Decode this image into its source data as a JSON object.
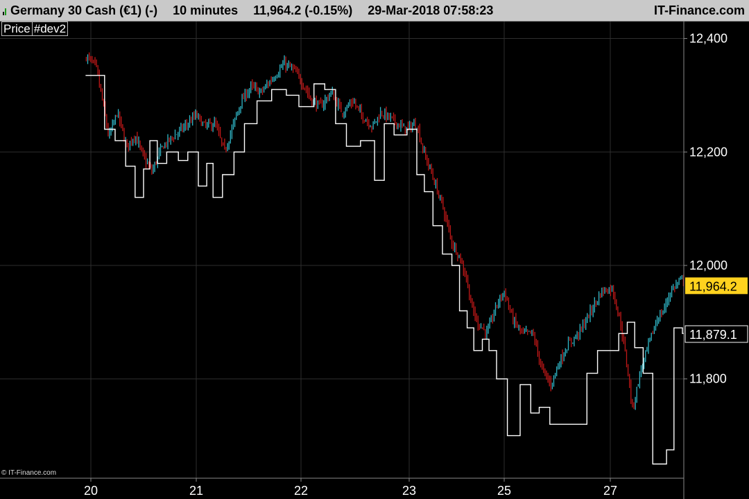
{
  "header": {
    "instrument": "Germany 30 Cash (€1) (-)",
    "timeframe": "10 minutes",
    "last": "11,964.2 (-0.15%)",
    "datetime": "29-Mar-2018 07:58:23",
    "brand": "IT-Finance.com"
  },
  "legend": {
    "price_label": "Price",
    "indicator_label": "#dev2"
  },
  "copyright": "© IT-Finance.com",
  "chart_data": {
    "type": "line",
    "xlabel": "",
    "ylabel": "",
    "x_tick_labels": [
      "20",
      "21",
      "22",
      "23",
      "25",
      "27"
    ],
    "ylim": [
      11625,
      12430
    ],
    "y_ticks": [
      11800,
      12000,
      12200,
      12400
    ],
    "y_tick_labels": [
      "11,800",
      "12,000",
      "12,200",
      "12,400"
    ],
    "grid": true,
    "price_badge": {
      "value": 11964.2,
      "label": "11,964.2"
    },
    "indicator_badge": {
      "value": 11879.1,
      "label": "11,879.1"
    },
    "colors": {
      "background": "#000000",
      "grid": "#2e2e2e",
      "up_bar": "#30b8c8",
      "down_bar": "#c01818",
      "indicator": "#ffffff",
      "price_badge": "#ffd21e"
    },
    "series": [
      {
        "type": "candlestick-trace",
        "points": [
          [
            -0.05,
            12370
          ],
          [
            0.05,
            12350
          ],
          [
            0.12,
            12280
          ],
          [
            0.17,
            12225
          ],
          [
            0.25,
            12270
          ],
          [
            0.34,
            12210
          ],
          [
            0.42,
            12230
          ],
          [
            0.5,
            12190
          ],
          [
            0.58,
            12165
          ],
          [
            0.68,
            12210
          ],
          [
            0.8,
            12230
          ],
          [
            0.92,
            12250
          ],
          [
            1.0,
            12265
          ],
          [
            1.08,
            12245
          ],
          [
            1.18,
            12250
          ],
          [
            1.27,
            12200
          ],
          [
            1.34,
            12240
          ],
          [
            1.42,
            12285
          ],
          [
            1.52,
            12315
          ],
          [
            1.62,
            12305
          ],
          [
            1.75,
            12335
          ],
          [
            1.84,
            12355
          ],
          [
            1.93,
            12345
          ],
          [
            2.02,
            12320
          ],
          [
            2.1,
            12290
          ],
          [
            2.18,
            12280
          ],
          [
            2.28,
            12305
          ],
          [
            2.38,
            12270
          ],
          [
            2.48,
            12290
          ],
          [
            2.56,
            12265
          ],
          [
            2.66,
            12245
          ],
          [
            2.74,
            12270
          ],
          [
            2.86,
            12255
          ],
          [
            2.96,
            12240
          ],
          [
            3.08,
            12250
          ],
          [
            3.15,
            12200
          ],
          [
            3.22,
            12170
          ],
          [
            3.3,
            12130
          ],
          [
            3.36,
            12100
          ],
          [
            3.45,
            12040
          ],
          [
            3.52,
            12020
          ],
          [
            3.6,
            11980
          ],
          [
            3.66,
            11925
          ],
          [
            3.72,
            11900
          ],
          [
            3.82,
            11880
          ],
          [
            3.92,
            11930
          ],
          [
            4.0,
            11955
          ],
          [
            4.08,
            11905
          ],
          [
            4.17,
            11880
          ],
          [
            4.27,
            11880
          ],
          [
            4.36,
            11815
          ],
          [
            4.44,
            11790
          ],
          [
            4.52,
            11830
          ],
          [
            4.6,
            11860
          ],
          [
            4.7,
            11880
          ],
          [
            4.82,
            11920
          ],
          [
            4.92,
            11955
          ],
          [
            5.02,
            11960
          ],
          [
            5.1,
            11895
          ],
          [
            5.16,
            11820
          ],
          [
            5.21,
            11745
          ],
          [
            5.28,
            11810
          ],
          [
            5.36,
            11860
          ],
          [
            5.44,
            11905
          ],
          [
            5.5,
            11920
          ],
          [
            5.57,
            11955
          ],
          [
            5.64,
            11970
          ],
          [
            5.72,
            11980
          ],
          [
            5.81,
            11955
          ],
          [
            5.89,
            11980
          ],
          [
            5.95,
            12010
          ],
          [
            6.03,
            11985
          ],
          [
            6.12,
            11970
          ],
          [
            6.28,
            11965
          ]
        ]
      },
      {
        "type": "step",
        "points": [
          [
            -0.05,
            12335
          ],
          [
            0.13,
            12240
          ],
          [
            0.23,
            12220
          ],
          [
            0.33,
            12175
          ],
          [
            0.42,
            12120
          ],
          [
            0.5,
            12170
          ],
          [
            0.56,
            12220
          ],
          [
            0.63,
            12180
          ],
          [
            0.72,
            12200
          ],
          [
            0.83,
            12185
          ],
          [
            0.92,
            12200
          ],
          [
            1.02,
            12140
          ],
          [
            1.1,
            12180
          ],
          [
            1.16,
            12120
          ],
          [
            1.25,
            12160
          ],
          [
            1.36,
            12200
          ],
          [
            1.46,
            12250
          ],
          [
            1.58,
            12290
          ],
          [
            1.72,
            12310
          ],
          [
            1.86,
            12300
          ],
          [
            1.98,
            12280
          ],
          [
            2.12,
            12320
          ],
          [
            2.22,
            12310
          ],
          [
            2.32,
            12250
          ],
          [
            2.42,
            12210
          ],
          [
            2.55,
            12220
          ],
          [
            2.68,
            12150
          ],
          [
            2.77,
            12250
          ],
          [
            2.86,
            12230
          ],
          [
            2.98,
            12240
          ],
          [
            3.08,
            12160
          ],
          [
            3.16,
            12130
          ],
          [
            3.25,
            12070
          ],
          [
            3.35,
            12020
          ],
          [
            3.45,
            12000
          ],
          [
            3.53,
            11920
          ],
          [
            3.61,
            11890
          ],
          [
            3.68,
            11850
          ],
          [
            3.77,
            11870
          ],
          [
            3.84,
            11850
          ],
          [
            3.92,
            11800
          ],
          [
            4.03,
            11700
          ],
          [
            4.15,
            11790
          ],
          [
            4.25,
            11740
          ],
          [
            4.33,
            11750
          ],
          [
            4.43,
            11720
          ],
          [
            4.54,
            11720
          ],
          [
            4.65,
            11720
          ],
          [
            4.78,
            11810
          ],
          [
            4.88,
            11850
          ],
          [
            4.98,
            11850
          ],
          [
            5.08,
            11880
          ],
          [
            5.16,
            11900
          ],
          [
            5.23,
            11855
          ],
          [
            5.31,
            11810
          ],
          [
            5.4,
            11650
          ],
          [
            5.53,
            11675
          ],
          [
            5.6,
            11890
          ],
          [
            5.68,
            11880
          ],
          [
            5.78,
            11900
          ],
          [
            5.88,
            11880
          ],
          [
            5.98,
            11940
          ],
          [
            6.08,
            11915
          ],
          [
            6.18,
            11950
          ],
          [
            6.28,
            11879
          ]
        ]
      }
    ]
  }
}
